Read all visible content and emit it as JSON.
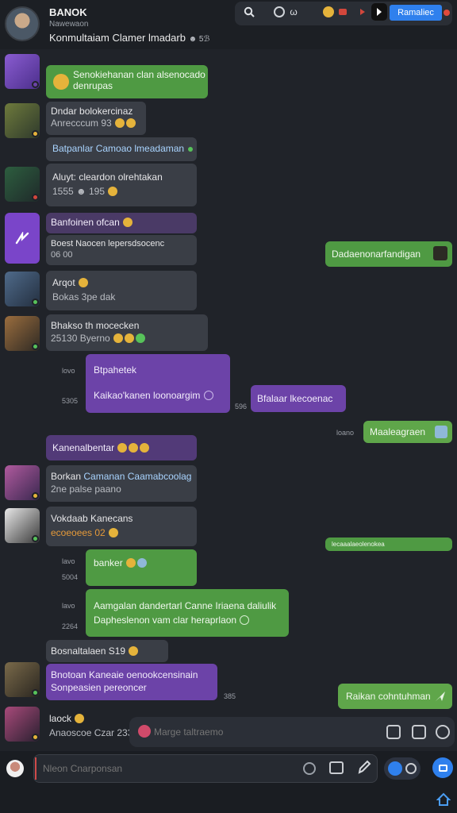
{
  "header": {
    "name": "BANOK",
    "status": "Nawewaon",
    "description": "Konmultaiam Clamer lmadarb",
    "description_meta": "☻ 5ℬ",
    "toolbar_label_1": "ω",
    "toolbar_label_2": "☻",
    "primary_button": "Ramaliec"
  },
  "messages": [
    {
      "text": "Senokiehanan clan alsenocado",
      "text2": "denrupas"
    },
    {
      "line1": "Dndar bolokercinaz",
      "line2": "Anrecccum  93"
    },
    {
      "line1": "Batpanlar Camoao lmeadaman"
    },
    {
      "line1": "Aluyt:  cleardon olrehtakan",
      "line2": "1555  ☻ 195"
    },
    {
      "line1": "Banfoinen  ofcan"
    },
    {
      "line1": "Boest  Naocen lepersdsocenc",
      "line2": "06 00"
    },
    {
      "text": "Dadaenonarfandigan"
    },
    {
      "line1": "Arqot",
      "line2": "Bokas 3pe  dak"
    },
    {
      "line1": "Bhakso th mocecken",
      "line2": "25130  Byerno"
    },
    {
      "ts1": "lovo",
      "line1": "Btpahetek",
      "ts2": "5305",
      "line2": "Kaikao'kanen loonoargim"
    },
    {
      "text": "Bfalaar lkecoenac",
      "ts": "596"
    },
    {
      "ts": "loano",
      "text": "Maaleagraen"
    },
    {
      "text": "Kanenalbentar"
    },
    {
      "line1": "Borkan",
      "line1b": "Camanan Caamabcoolag",
      "line2": "2ne palse  paano"
    },
    {
      "line1": "Vokdaab Kanecans",
      "line2": "ecoeoees  02"
    },
    {
      "text": "lecaaalaeolenokea"
    },
    {
      "ts": "lavo",
      "text": "banker"
    },
    {
      "ts": "5004",
      "ts2": "lavo",
      "ts3": "2264",
      "line1": "Aamgalan dandertarl Canne Iriaena daliulik",
      "line2": "Dapheslenon vam clar heraprlaon"
    },
    {
      "text": "Bosnaltalaen  S19"
    },
    {
      "line1": "Bnotoan Kaneaie oenookcensinain",
      "line2": "Sonpeasien pereoncer",
      "ts": "385"
    },
    {
      "text": "Raikan cohntuhman"
    },
    {
      "line1": "laock",
      "line2": "Anaoscoe Czar  233"
    }
  ],
  "composer_float": {
    "placeholder": "Marge taltraemo"
  },
  "composer": {
    "placeholder": "Nleon Cnarponsan"
  },
  "colors": {
    "green": "#4f9a43",
    "purple": "#6c43a8",
    "gray": "#3a3e46",
    "accent": "#2f80ed"
  }
}
